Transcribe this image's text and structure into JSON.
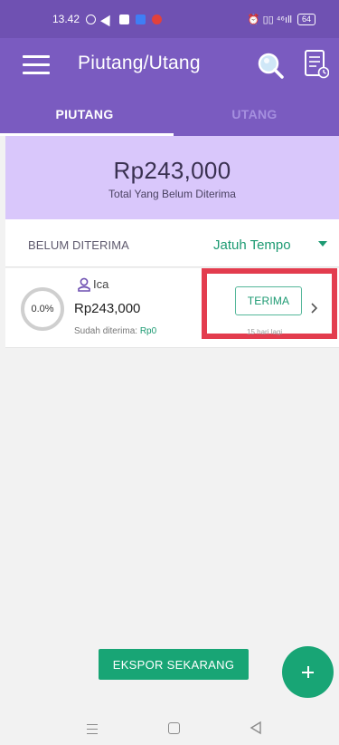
{
  "status_bar": {
    "time": "13.42",
    "right_text": "⏰ ▯▯ ⁴⁶ıll",
    "battery": "64"
  },
  "app_bar": {
    "title": "Piutang/Utang",
    "icons": [
      "menu-icon",
      "search-icon",
      "report-icon"
    ]
  },
  "tabs": [
    {
      "label": "PIUTANG",
      "active": true
    },
    {
      "label": "UTANG",
      "active": false
    }
  ],
  "summary": {
    "amount": "Rp243,000",
    "caption": "Total Yang Belum Diterima"
  },
  "filter": {
    "label": "BELUM DITERIMA",
    "sort_value": "Jatuh Tempo"
  },
  "items": [
    {
      "progress_label": "0.0%",
      "progress": 0.0,
      "name": "Ica",
      "amount": "Rp243,000",
      "received_label": "Sudah diterima: ",
      "received_value": "Rp0",
      "action_label": "TERIMA",
      "due_text": "15 hari lagi"
    }
  ],
  "actions": {
    "export_label": "EKSPOR SEKARANG",
    "fab_icon": "plus-icon"
  },
  "colors": {
    "primary": "#7a5bc0",
    "status_bar": "#6f51b2",
    "summary_bg": "#d9c7fb",
    "accent_green": "#18a575",
    "highlight": "#e33c4e"
  }
}
